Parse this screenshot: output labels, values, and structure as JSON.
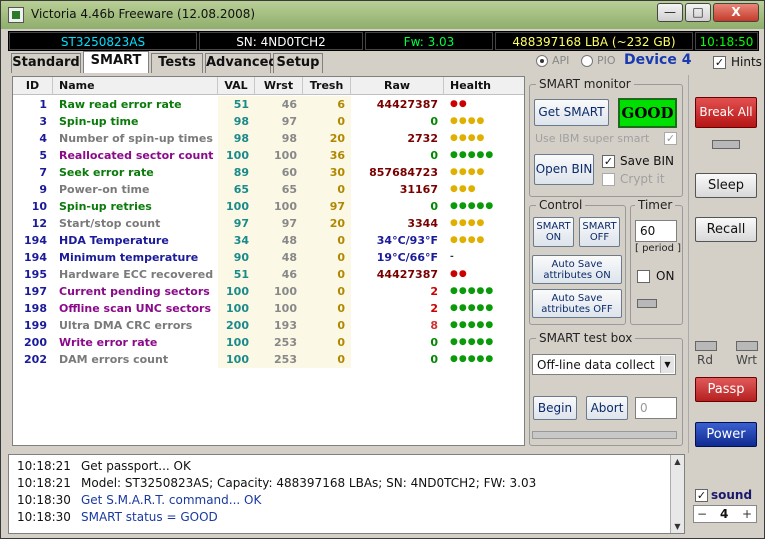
{
  "window": {
    "title": "Victoria 4.46b Freeware (12.08.2008)",
    "min_glyph": "—",
    "max_glyph": "□",
    "close_glyph": "X"
  },
  "status": {
    "model": "ST3250823AS",
    "serial": "SN: 4ND0TCH2",
    "firmware": "Fw: 3.03",
    "capacity": "488397168 LBA (~232 GB)",
    "time": "10:18:50"
  },
  "tabs": [
    {
      "label": "Standard"
    },
    {
      "label": "SMART"
    },
    {
      "label": "Tests"
    },
    {
      "label": "Advanced"
    },
    {
      "label": "Setup"
    }
  ],
  "mode": {
    "api_label": "API",
    "pio_label": "PIO",
    "device_label": "Device 4",
    "hints_label": "Hints"
  },
  "table": {
    "headers": [
      "ID",
      "Name",
      "VAL",
      "Wrst",
      "Tresh",
      "Raw",
      "Health"
    ],
    "rows": [
      {
        "id": "1",
        "name": "Raw read error rate",
        "val": "51",
        "wrst": "46",
        "tresh": "6",
        "raw": "44427387",
        "health": "●●",
        "name_color": "#0a7a0a",
        "raw_color": "#7a0000",
        "health_color": "#cc0000"
      },
      {
        "id": "3",
        "name": "Spin-up time",
        "val": "98",
        "wrst": "97",
        "tresh": "0",
        "raw": "0",
        "health": "●●●●",
        "name_color": "#0a7a0a",
        "raw_color": "#008800",
        "health_color": "#e0b000"
      },
      {
        "id": "4",
        "name": "Number of spin-up times",
        "val": "98",
        "wrst": "98",
        "tresh": "20",
        "raw": "2732",
        "health": "●●●●",
        "name_color": "#7a7a7a",
        "raw_color": "#7a0000",
        "health_color": "#e0b000"
      },
      {
        "id": "5",
        "name": "Reallocated sector count",
        "val": "100",
        "wrst": "100",
        "tresh": "36",
        "raw": "0",
        "health": "●●●●●",
        "name_color": "#8a0a8a",
        "raw_color": "#008800",
        "health_color": "#0a9a0a"
      },
      {
        "id": "7",
        "name": "Seek error rate",
        "val": "89",
        "wrst": "60",
        "tresh": "30",
        "raw": "857684723",
        "health": "●●●●",
        "name_color": "#0a7a0a",
        "raw_color": "#7a0000",
        "health_color": "#e0b000"
      },
      {
        "id": "9",
        "name": "Power-on time",
        "val": "65",
        "wrst": "65",
        "tresh": "0",
        "raw": "31167",
        "health": "●●●",
        "name_color": "#7a7a7a",
        "raw_color": "#7a0000",
        "health_color": "#e0b000"
      },
      {
        "id": "10",
        "name": "Spin-up retries",
        "val": "100",
        "wrst": "100",
        "tresh": "97",
        "raw": "0",
        "health": "●●●●●",
        "name_color": "#0a7a0a",
        "raw_color": "#008800",
        "health_color": "#0a9a0a"
      },
      {
        "id": "12",
        "name": "Start/stop count",
        "val": "97",
        "wrst": "97",
        "tresh": "20",
        "raw": "3344",
        "health": "●●●●",
        "name_color": "#7a7a7a",
        "raw_color": "#7a0000",
        "health_color": "#e0b000"
      },
      {
        "id": "194",
        "name": "HDA Temperature",
        "val": "34",
        "wrst": "48",
        "tresh": "0",
        "raw": "34°C/93°F",
        "health": "●●●●",
        "name_color": "#1a1a9a",
        "raw_color": "#1a1a9a",
        "health_color": "#e0b000"
      },
      {
        "id": "194",
        "name": "Minimum temperature",
        "val": "90",
        "wrst": "48",
        "tresh": "0",
        "raw": "19°C/66°F",
        "health": "-",
        "name_color": "#1a1a9a",
        "raw_color": "#1a1a9a",
        "health_color": "#333333"
      },
      {
        "id": "195",
        "name": "Hardware ECC recovered",
        "val": "51",
        "wrst": "46",
        "tresh": "0",
        "raw": "44427387",
        "health": "●●",
        "name_color": "#7a7a7a",
        "raw_color": "#7a0000",
        "health_color": "#cc0000"
      },
      {
        "id": "197",
        "name": "Current pending sectors",
        "val": "100",
        "wrst": "100",
        "tresh": "0",
        "raw": "2",
        "health": "●●●●●",
        "name_color": "#8a0a8a",
        "raw_color": "#cc0000",
        "health_color": "#0a9a0a"
      },
      {
        "id": "198",
        "name": "Offline scan UNC sectors",
        "val": "100",
        "wrst": "100",
        "tresh": "0",
        "raw": "2",
        "health": "●●●●●",
        "name_color": "#8a0a8a",
        "raw_color": "#cc0000",
        "health_color": "#0a9a0a"
      },
      {
        "id": "199",
        "name": "Ultra DMA CRC errors",
        "val": "200",
        "wrst": "193",
        "tresh": "0",
        "raw": "8",
        "health": "●●●●●",
        "name_color": "#7a7a7a",
        "raw_color": "#cc3333",
        "health_color": "#0a9a0a"
      },
      {
        "id": "200",
        "name": "Write error rate",
        "val": "100",
        "wrst": "253",
        "tresh": "0",
        "raw": "0",
        "health": "●●●●●",
        "name_color": "#8a0a8a",
        "raw_color": "#008800",
        "health_color": "#0a9a0a"
      },
      {
        "id": "202",
        "name": "DAM errors count",
        "val": "100",
        "wrst": "253",
        "tresh": "0",
        "raw": "0",
        "health": "●●●●●",
        "name_color": "#7a7a7a",
        "raw_color": "#008800",
        "health_color": "#0a9a0a"
      }
    ]
  },
  "smart_monitor": {
    "title": "SMART monitor",
    "get_smart": "Get SMART",
    "status": "GOOD",
    "ibm_label": "Use IBM super smart",
    "open_bin": "Open BIN",
    "save_bin": "Save BIN",
    "crypt_label": "Crypt it"
  },
  "control": {
    "title": "Control",
    "smart_on": "SMART ON",
    "smart_off": "SMART OFF",
    "auto_on": "Auto Save attributes ON",
    "auto_off": "Auto Save attributes OFF"
  },
  "timer": {
    "title": "Timer",
    "value": "60",
    "period_label": "[ period ]",
    "on_label": "ON"
  },
  "test_box": {
    "title": "SMART test box",
    "selected": "Off-line data collect",
    "begin": "Begin",
    "abort": "Abort",
    "counter": "0"
  },
  "side": {
    "break_all": "Break All",
    "sleep": "Sleep",
    "recall": "Recall",
    "rd": "Rd",
    "wrt": "Wrt",
    "passp": "Passp",
    "power": "Power",
    "sound": "sound",
    "sound_value": "4",
    "minus": "−",
    "plus": "+"
  },
  "log": [
    {
      "time": "10:18:21",
      "text": "Get passport... OK",
      "color": "#111111"
    },
    {
      "time": "10:18:21",
      "text": "Model: ST3250823AS; Capacity: 488397168 LBAs; SN: 4ND0TCH2; FW: 3.03",
      "color": "#111111"
    },
    {
      "time": "10:18:30",
      "text": "Get S.M.A.R.T. command... OK",
      "color": "#1a3aa0"
    },
    {
      "time": "10:18:30",
      "text": "SMART status = GOOD",
      "color": "#1a3aa0"
    }
  ],
  "colors": {
    "status_model": "#00e0ff",
    "status_serial": "#ffffff",
    "status_fw": "#00ff44",
    "status_cap": "#ffff66",
    "status_time": "#00ff00",
    "id_col": "#1a1a9a",
    "val_col": "#1a8a8a",
    "num_col": "#888888",
    "tresh_col": "#b08800",
    "break_all": "#cc2020",
    "passp": "#c83030",
    "power": "#1a3ab0"
  }
}
